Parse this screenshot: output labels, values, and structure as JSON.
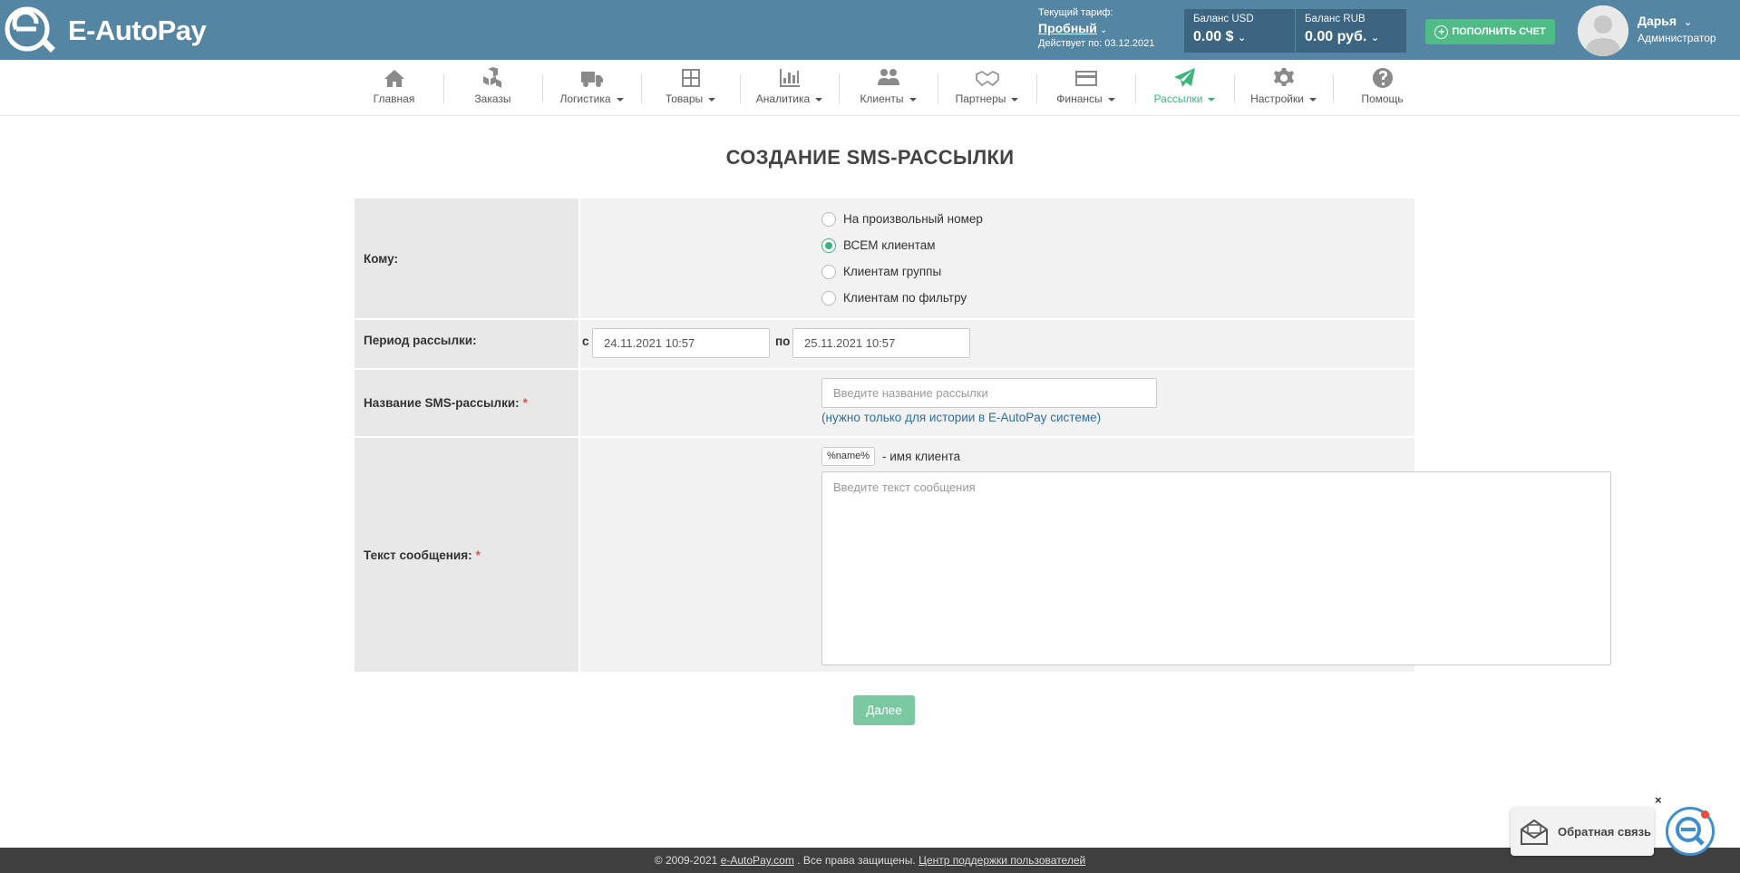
{
  "header": {
    "logo_text": "E-AutoPay",
    "tariff_label": "Текущий тариф:",
    "tariff_name": "Пробный",
    "tariff_valid": "Действует по: 03.12.2021",
    "balance_usd_label": "Баланс USD",
    "balance_usd_value": "0.00 $",
    "balance_rub_label": "Баланс RUB",
    "balance_rub_value": "0.00 руб.",
    "topup_label": "ПОПОЛНИТЬ СЧЕТ",
    "user_name": "Дарья",
    "user_role": "Администратор"
  },
  "nav": [
    {
      "label": "Главная",
      "icon": "home-icon",
      "dropdown": false,
      "active": false
    },
    {
      "label": "Заказы",
      "icon": "boxes-icon",
      "dropdown": false,
      "active": false
    },
    {
      "label": "Логистика",
      "icon": "truck-icon",
      "dropdown": true,
      "active": false
    },
    {
      "label": "Товары",
      "icon": "shelves-icon",
      "dropdown": true,
      "active": false
    },
    {
      "label": "Аналитика",
      "icon": "bar-chart-icon",
      "dropdown": true,
      "active": false
    },
    {
      "label": "Клиенты",
      "icon": "users-icon",
      "dropdown": true,
      "active": false
    },
    {
      "label": "Партнеры",
      "icon": "handshake-icon",
      "dropdown": true,
      "active": false
    },
    {
      "label": "Финансы",
      "icon": "credit-card-icon",
      "dropdown": true,
      "active": false
    },
    {
      "label": "Рассылки",
      "icon": "paper-plane-icon",
      "dropdown": true,
      "active": true
    },
    {
      "label": "Настройки",
      "icon": "gear-icon",
      "dropdown": true,
      "active": false
    },
    {
      "label": "Помощь",
      "icon": "question-icon",
      "dropdown": false,
      "active": false
    }
  ],
  "page": {
    "title": "СОЗДАНИЕ SMS-РАССЫЛКИ"
  },
  "form": {
    "recipients_label": "Кому:",
    "recipient_options": [
      {
        "label": "На произвольный номер",
        "checked": false
      },
      {
        "label": "ВСЕМ клиентам",
        "checked": true
      },
      {
        "label": "Клиентам группы",
        "checked": false
      },
      {
        "label": "Клиентам по фильтру",
        "checked": false
      }
    ],
    "period_label": "Период рассылки:",
    "period_from_prefix": "с",
    "period_from": "24.11.2021 10:57",
    "period_to_prefix": "по",
    "period_to": "25.11.2021 10:57",
    "name_label": "Название SMS-рассылки:",
    "name_placeholder": "Введите название рассылки",
    "name_hint": "(нужно только для истории в E-AutoPay системе)",
    "message_label": "Текст сообщения:",
    "message_tag": "%name%",
    "message_tag_desc": "- имя клиента",
    "message_placeholder": "Введите текст сообщения",
    "required_mark": "*",
    "next_button": "Далее"
  },
  "footer": {
    "copyright": "© 2009-2021",
    "site_link": "e-AutoPay.com",
    "rights": ". Все права защищены.",
    "support_link": "Центр поддержки пользователей"
  },
  "feedback": {
    "label": "Обратная связь",
    "close": "×"
  },
  "colors": {
    "header_bg": "#5485a3",
    "accent_green": "#3bb57c",
    "footer_bg": "#3f3f3f"
  }
}
